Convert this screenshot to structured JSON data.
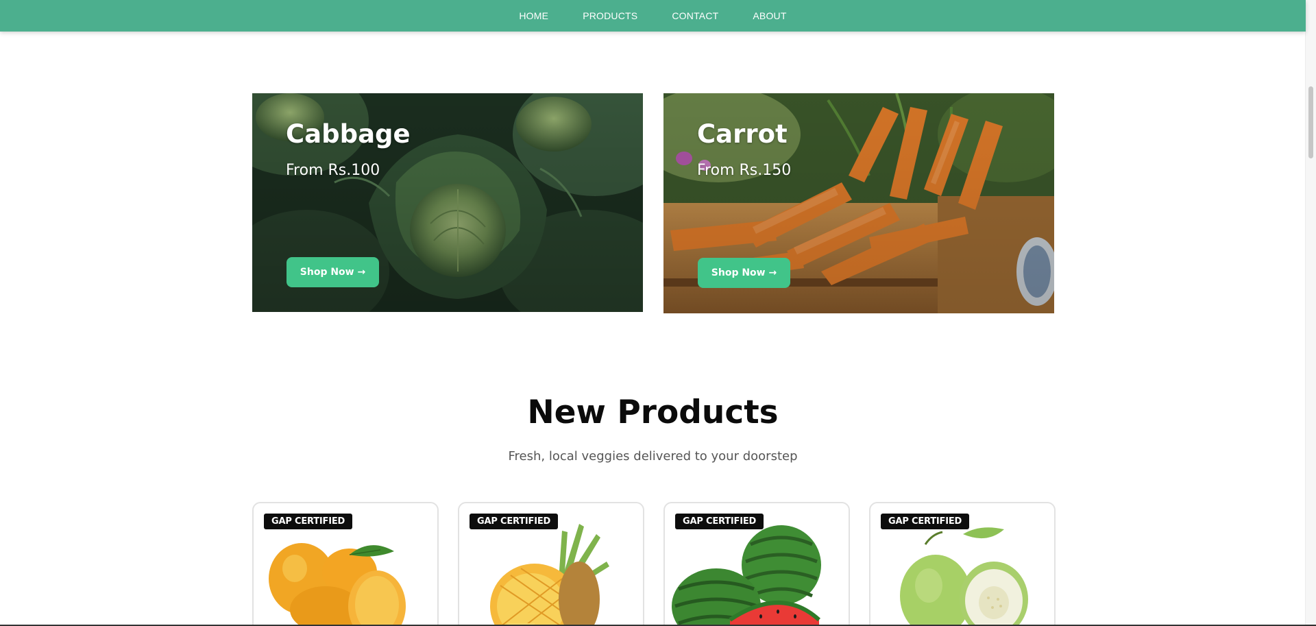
{
  "nav": {
    "items": [
      {
        "label": "HOME"
      },
      {
        "label": "PRODUCTS"
      },
      {
        "label": "CONTACT"
      },
      {
        "label": "ABOUT"
      }
    ]
  },
  "banners": [
    {
      "title": "Cabbage",
      "price": "From Rs.100",
      "button": "Shop Now →",
      "image": "cabbage-photo"
    },
    {
      "title": "Carrot",
      "price": "From Rs.150",
      "button": "Shop Now →",
      "image": "carrot-photo"
    }
  ],
  "new_products": {
    "title": "New Products",
    "subtitle": "Fresh, local veggies delivered to your doorstep",
    "cards": [
      {
        "badge": "GAP CERTIFIED",
        "image": "mango-photo"
      },
      {
        "badge": "GAP CERTIFIED",
        "image": "pineapple-photo"
      },
      {
        "badge": "GAP CERTIFIED",
        "image": "watermelon-photo"
      },
      {
        "badge": "GAP CERTIFIED",
        "image": "guava-photo"
      }
    ]
  },
  "colors": {
    "nav_bg": "#4caf8e",
    "button_bg": "#41c489",
    "badge_bg": "#0d0d0d"
  }
}
